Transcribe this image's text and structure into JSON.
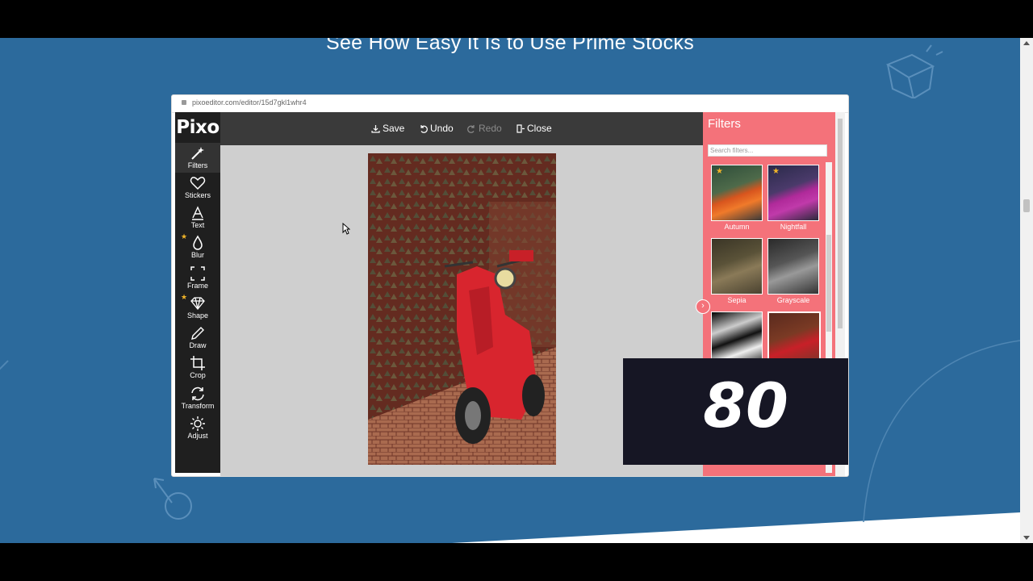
{
  "page": {
    "headline": "See How Easy It Is to Use Prime Stocks"
  },
  "browser": {
    "url": "pixoeditor.com/editor/15d7gkl1whr4"
  },
  "editor": {
    "logo": "Pixo",
    "toolbar": {
      "save": "Save",
      "undo": "Undo",
      "redo": "Redo",
      "close": "Close"
    },
    "tools": [
      {
        "label": "Filters",
        "icon": "magic-wand-icon",
        "active": true,
        "star": false
      },
      {
        "label": "Stickers",
        "icon": "heart-icon",
        "active": false,
        "star": false
      },
      {
        "label": "Text",
        "icon": "text-icon",
        "active": false,
        "star": false
      },
      {
        "label": "Blur",
        "icon": "drop-icon",
        "active": false,
        "star": true
      },
      {
        "label": "Frame",
        "icon": "frame-icon",
        "active": false,
        "star": false
      },
      {
        "label": "Shape",
        "icon": "diamond-icon",
        "active": false,
        "star": true
      },
      {
        "label": "Draw",
        "icon": "pencil-icon",
        "active": false,
        "star": false
      },
      {
        "label": "Crop",
        "icon": "crop-icon",
        "active": false,
        "star": false
      },
      {
        "label": "Transform",
        "icon": "rotate-icon",
        "active": false,
        "star": false
      },
      {
        "label": "Adjust",
        "icon": "sun-icon",
        "active": false,
        "star": false
      }
    ],
    "filters": {
      "title": "Filters",
      "search_placeholder": "Search filters...",
      "items": [
        {
          "name": "Autumn",
          "star": true
        },
        {
          "name": "Nightfall",
          "star": true
        },
        {
          "name": "Sepia",
          "star": false
        },
        {
          "name": "Grayscale",
          "star": false
        }
      ]
    }
  },
  "overlay": {
    "number": "80"
  },
  "colors": {
    "page_bg": "#2c6a9c",
    "filters_panel": "#f4727a",
    "sidebar": "#1f1f1f",
    "topbar": "#3a3a3a",
    "overlay": "#161624"
  }
}
